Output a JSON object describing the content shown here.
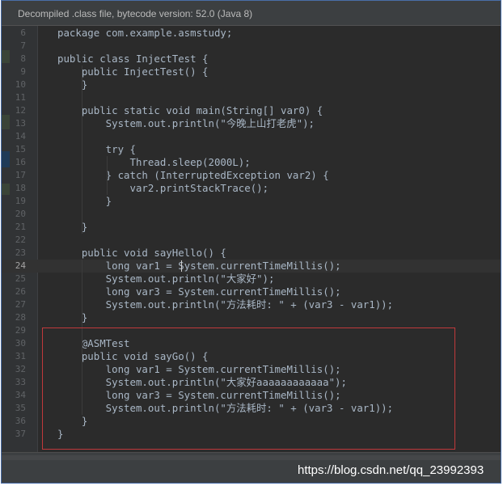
{
  "banner": {
    "text": "Decompiled .class file, bytecode version: 52.0 (Java 8)"
  },
  "editor": {
    "current_line": "24",
    "lines": [
      {
        "n": "6",
        "text": "package com.example.asmstudy;"
      },
      {
        "n": "7",
        "text": ""
      },
      {
        "n": "8",
        "text": "public class InjectTest {"
      },
      {
        "n": "9",
        "text": "    public InjectTest() {"
      },
      {
        "n": "10",
        "text": "    }"
      },
      {
        "n": "11",
        "text": ""
      },
      {
        "n": "12",
        "text": "    public static void main(String[] var0) {"
      },
      {
        "n": "13",
        "text": "        System.out.println(\"今晚上山打老虎\");"
      },
      {
        "n": "14",
        "text": ""
      },
      {
        "n": "15",
        "text": "        try {"
      },
      {
        "n": "16",
        "text": "            Thread.sleep(2000L);"
      },
      {
        "n": "17",
        "text": "        } catch (InterruptedException var2) {"
      },
      {
        "n": "18",
        "text": "            var2.printStackTrace();"
      },
      {
        "n": "19",
        "text": "        }"
      },
      {
        "n": "20",
        "text": ""
      },
      {
        "n": "21",
        "text": "    }"
      },
      {
        "n": "22",
        "text": ""
      },
      {
        "n": "23",
        "text": "    public void sayHello() {"
      },
      {
        "n": "24",
        "text": "        long var1 = System.currentTimeMillis();"
      },
      {
        "n": "25",
        "text": "        System.out.println(\"大家好\");"
      },
      {
        "n": "26",
        "text": "        long var3 = System.currentTimeMillis();"
      },
      {
        "n": "27",
        "text": "        System.out.println(\"方法耗时: \" + (var3 - var1));"
      },
      {
        "n": "28",
        "text": "    }"
      },
      {
        "n": "29",
        "text": ""
      },
      {
        "n": "30",
        "text": "    @ASMTest"
      },
      {
        "n": "31",
        "text": "    public void sayGo() {"
      },
      {
        "n": "32",
        "text": "        long var1 = System.currentTimeMillis();"
      },
      {
        "n": "33",
        "text": "        System.out.println(\"大家好aaaaaaaaaaaa\");"
      },
      {
        "n": "34",
        "text": "        long var3 = System.currentTimeMillis();"
      },
      {
        "n": "35",
        "text": "        System.out.println(\"方法耗时: \" + (var3 - var1));"
      },
      {
        "n": "36",
        "text": "    }"
      },
      {
        "n": "37",
        "text": "}"
      }
    ]
  },
  "watermark": "https://blog.csdn.net/qq_23992393",
  "colors": {
    "editor_bg": "#2b2b2b",
    "gutter_bg": "#313335",
    "code_fg": "#a9b7c6",
    "line_number_fg": "#606366",
    "highlight_border": "#c0393b",
    "frame_border": "#4a6ea8"
  }
}
